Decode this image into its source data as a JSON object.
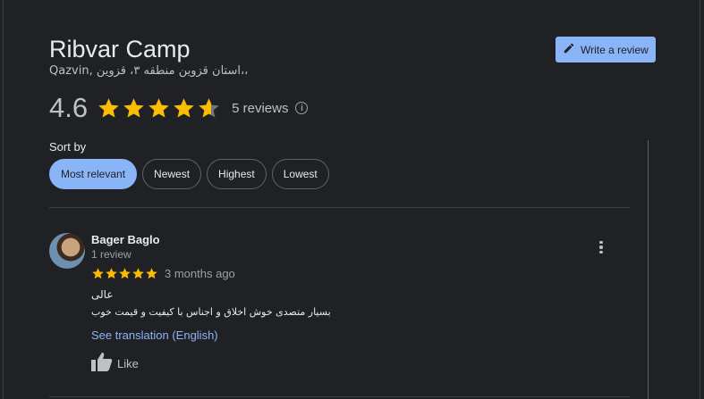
{
  "place": {
    "name": "Ribvar Camp",
    "address": "Qazvin, استان قزوین منطقه ۳، قزوین،،"
  },
  "header": {
    "write_review_label": "Write a review",
    "rating_value": "4.6",
    "rating_stars": 4.6,
    "reviews_count_label": "5 reviews",
    "info_icon": "info-icon"
  },
  "sort": {
    "label": "Sort by",
    "options": [
      "Most relevant",
      "Newest",
      "Highest",
      "Lowest"
    ],
    "selected": "Most relevant"
  },
  "reviews": [
    {
      "author": "Bager Baglo",
      "meta": "1 review",
      "stars": 5,
      "date": "3 months ago",
      "text_line1": "عالی",
      "text_line2": "بسیار متصدی خوش اخلاق و اجناس با کیفیت و قیمت خوب",
      "translation_link": "See translation (English)",
      "like_label": "Like"
    }
  ],
  "colors": {
    "background": "#202124",
    "accent": "#8ab4f8",
    "star": "#fbbc04"
  }
}
